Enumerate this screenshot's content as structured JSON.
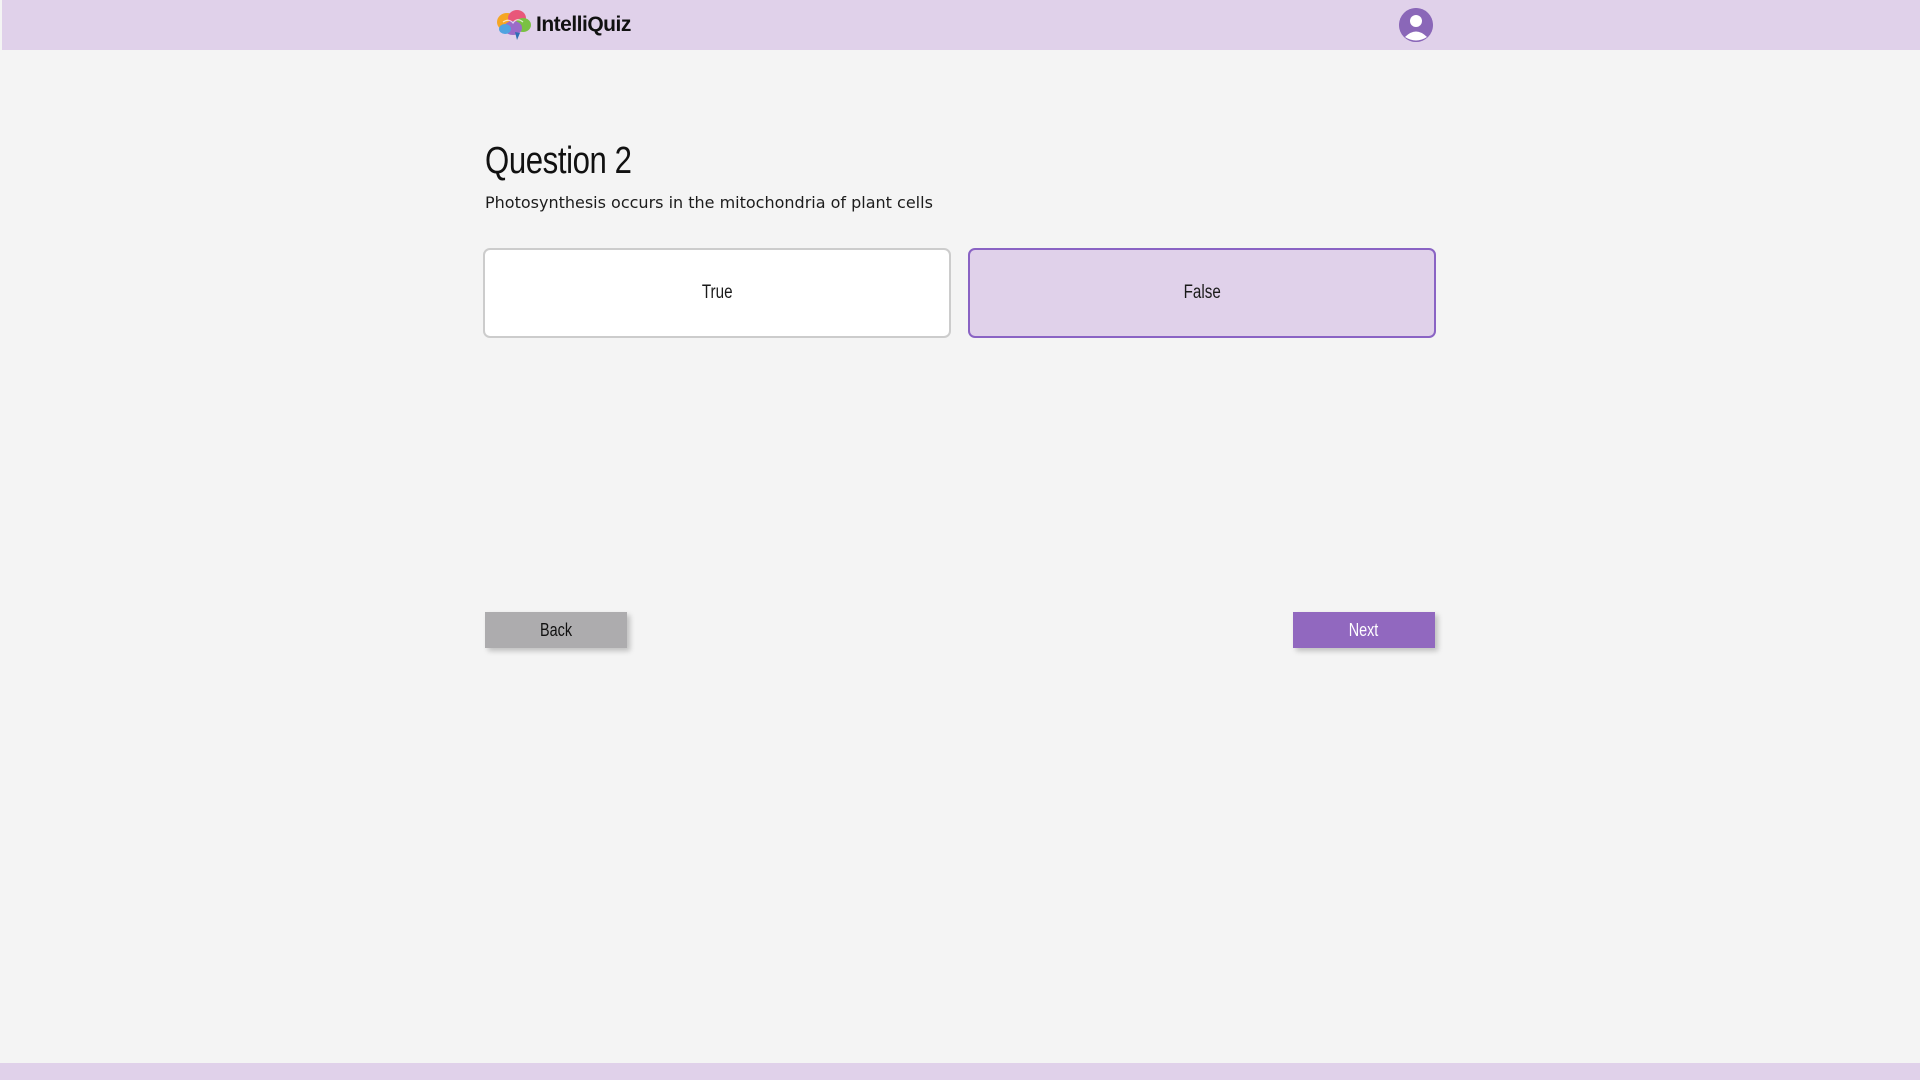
{
  "header": {
    "brand_name": "IntelliQuiz",
    "logo_icon": "brain-logo-icon",
    "avatar_icon": "user-avatar-icon"
  },
  "question": {
    "title": "Question 2",
    "text": "Photosynthesis occurs in the mitochondria of plant cells"
  },
  "options": [
    {
      "label": "True",
      "selected": false
    },
    {
      "label": "False",
      "selected": true
    }
  ],
  "navigation": {
    "back_label": "Back",
    "next_label": "Next"
  },
  "colors": {
    "header_bg": "#e0d1ea",
    "accent": "#9168bf",
    "selected_border": "#8a63c4",
    "page_bg": "#f4f4f4",
    "back_button": "#adacae"
  }
}
